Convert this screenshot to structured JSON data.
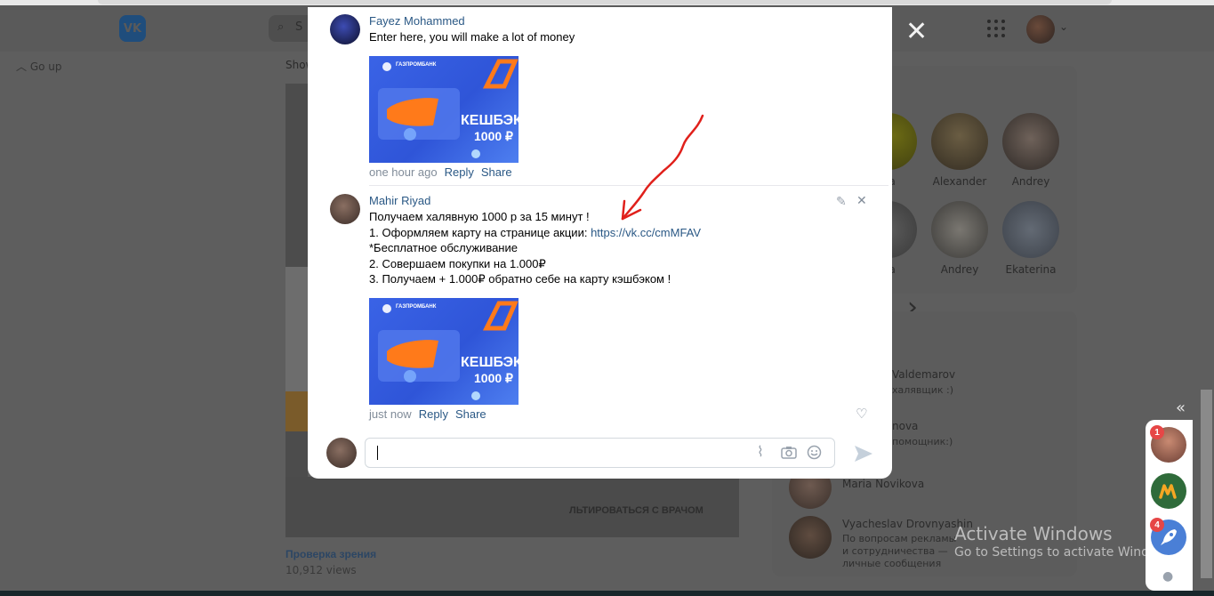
{
  "background": {
    "go_up": "Go up",
    "show_label": "Show",
    "search_placeholder": "S",
    "video": {
      "caption": "ЛЬТИРОВАТЬСЯ С ВРАЧОМ",
      "title": "Проверка зрения",
      "views": "10,912 views"
    },
    "friends": [
      {
        "name": "ria"
      },
      {
        "name": "Alexander"
      },
      {
        "name": "Andrey"
      },
      {
        "name": "ria"
      },
      {
        "name": "Andrey"
      },
      {
        "name": "Ekaterina"
      }
    ],
    "contacts": [
      {
        "name": "Valdemarov",
        "sub": "халявщик :)"
      },
      {
        "name": "nova",
        "sub": "помощник:)"
      },
      {
        "name": "Maria Novikova",
        "sub": ""
      },
      {
        "name": "Vyacheslav Drovnyashin",
        "sub": "По вопросам рекламы и сотрудничества — личные сообщения"
      }
    ],
    "activate_windows": {
      "title": "Activate Windows",
      "subtitle": "Go to Settings to activate Windows."
    }
  },
  "chat_sidebar": {
    "badges": [
      "1",
      "4"
    ]
  },
  "comments": [
    {
      "author": "Fayez Mohammed",
      "text": "Enter here, you will make a lot of money",
      "time": "one hour ago",
      "reply": "Reply",
      "share": "Share"
    },
    {
      "author": "Mahir Riyad",
      "lines": [
        "Получаем халявную 1000 р за 15 минут !",
        "1. Оформляем карту на странице акции: ",
        "*Бесплатное обслуживание",
        "2. Совершаем покупки на 1.000₽",
        "3. Получаем + 1.000₽ обратно себе на карту кэшбэком !"
      ],
      "link": "https://vk.cc/cmMFAV",
      "time": "just now",
      "reply": "Reply",
      "share": "Share"
    }
  ],
  "promo_image": {
    "brand": "ГАЗПРОМБАНК",
    "headline": "КЕШБЭК",
    "amount": "1000 ₽"
  },
  "composer": {
    "value": ""
  },
  "colors": {
    "link": "#2a5885",
    "annotation_arrow": "#e0201b",
    "badge": "#e64646"
  }
}
